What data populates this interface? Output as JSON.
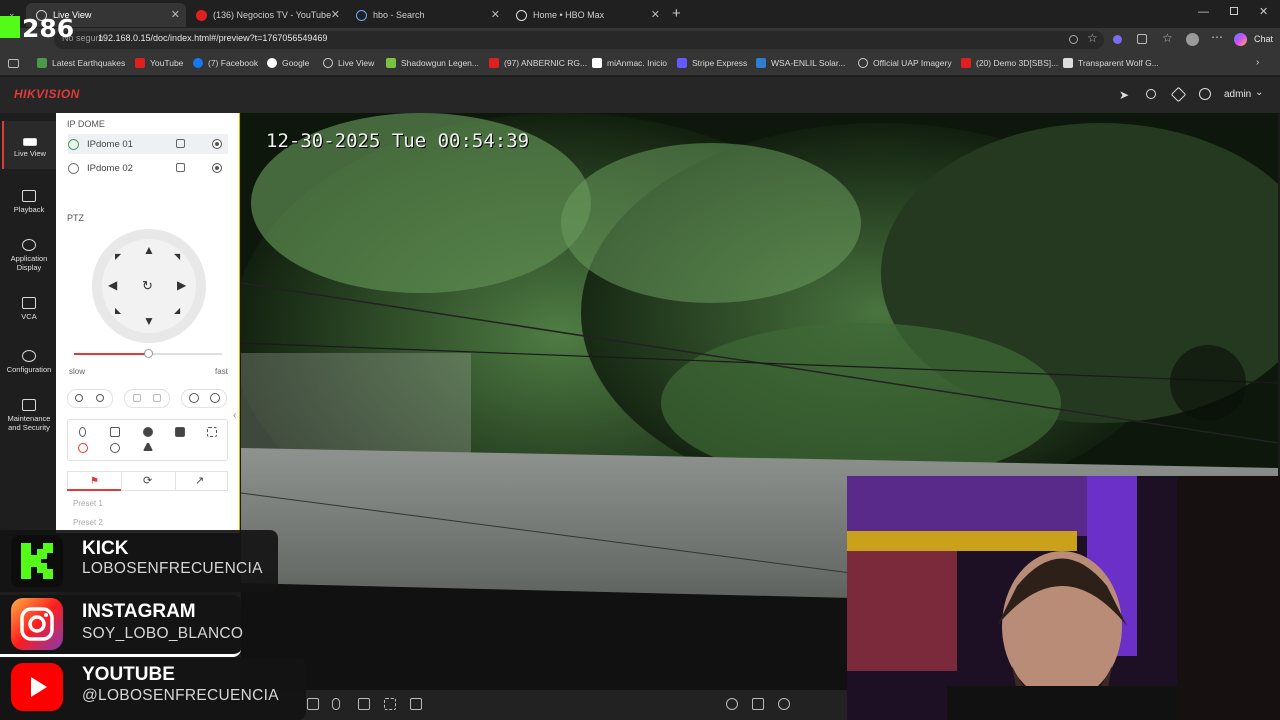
{
  "browser": {
    "tabs": [
      {
        "title": "Live View",
        "active": true
      },
      {
        "title": "(136) Negocios TV - YouTube",
        "active": false
      },
      {
        "title": "hbo - Search",
        "active": false
      },
      {
        "title": "Home • HBO Max",
        "active": false
      }
    ],
    "url_prefix": "No seguro",
    "url": "192.168.0.15/doc/index.html#/preview?t=1767056549469",
    "chat_label": "Chat",
    "bookmarks": [
      "Latest Earthquakes",
      "YouTube",
      "(7) Facebook",
      "Google",
      "Live View",
      "Shadowgun Legen...",
      "(97) ANBERNIC RG...",
      "miAnmac. Inicio",
      "Stripe Express",
      "WSA-ENLIL Solar...",
      "Official UAP Imagery",
      "(20) Demo 3D[SBS]...",
      "Transparent Wolf G..."
    ]
  },
  "app": {
    "brand": "HIKVISION",
    "user": "admin",
    "nav": [
      {
        "label": "Live View",
        "icon": "live-view-icon"
      },
      {
        "label": "Playback",
        "icon": "playback-icon"
      },
      {
        "label": "Application Display",
        "icon": "application-display-icon"
      },
      {
        "label": "VCA",
        "icon": "vca-icon"
      },
      {
        "label": "Configuration",
        "icon": "gear-icon"
      },
      {
        "label": "Maintenance and Security",
        "icon": "maintenance-icon"
      }
    ],
    "panel": {
      "section_title": "IP DOME",
      "cameras": [
        "IPdome 01",
        "IPdome 02"
      ],
      "ptz_title": "PTZ",
      "speed_slow": "slow",
      "speed_fast": "fast",
      "speed_level": 0.5,
      "presets": [
        "Preset 1",
        "Preset 2"
      ]
    },
    "video": {
      "osd_timestamp": "12-30-2025 Tue 00:54:39"
    }
  },
  "overlay": {
    "kick_count": "286",
    "socials": [
      {
        "platform": "KICK",
        "handle": "LOBOSENFRECUENCIA",
        "color": "#53fc18"
      },
      {
        "platform": "INSTAGRAM",
        "handle": "SOY_LOBO_BLANCO",
        "color": "#e1306c"
      },
      {
        "platform": "YOUTUBE",
        "handle": "@LOBOSENFRECUENCIA",
        "color": "#ff0000"
      }
    ]
  }
}
